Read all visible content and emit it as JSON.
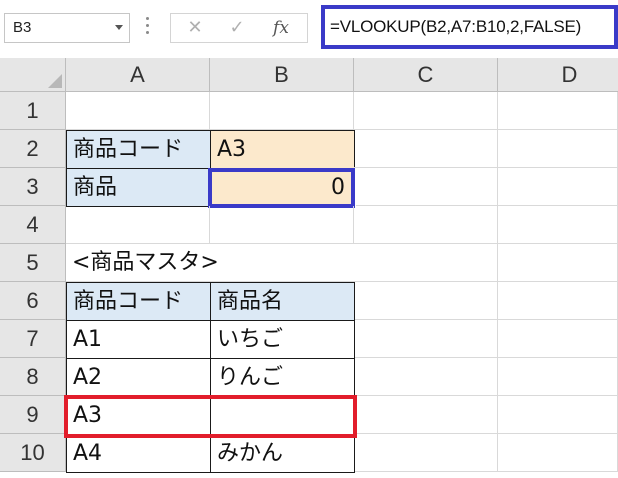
{
  "formula_bar": {
    "name_box": "B3",
    "cancel_symbol": "✕",
    "enter_symbol": "✓",
    "fx_symbol": "fx",
    "formula": "=VLOOKUP(B2,A7:B10,2,FALSE)"
  },
  "columns": [
    "A",
    "B",
    "C",
    "D"
  ],
  "rows": [
    "1",
    "2",
    "3",
    "4",
    "5",
    "6",
    "7",
    "8",
    "9",
    "10"
  ],
  "cells": {
    "A2": "商品コード",
    "B2": "A3",
    "A3": "商品",
    "B3": "0",
    "A5": "<商品マスタ>",
    "A6": "商品コード",
    "B6": "商品名",
    "A7": "A1",
    "B7": "いちご",
    "A8": "A2",
    "B8": "りんご",
    "A9": "A3",
    "B9": "",
    "A10": "A4",
    "B10": "みかん"
  },
  "colors": {
    "selection_border": "#3a3ac8",
    "highlight_border": "#e21d2b",
    "label_fill": "#dce9f5",
    "input_fill": "#fce9cc"
  }
}
